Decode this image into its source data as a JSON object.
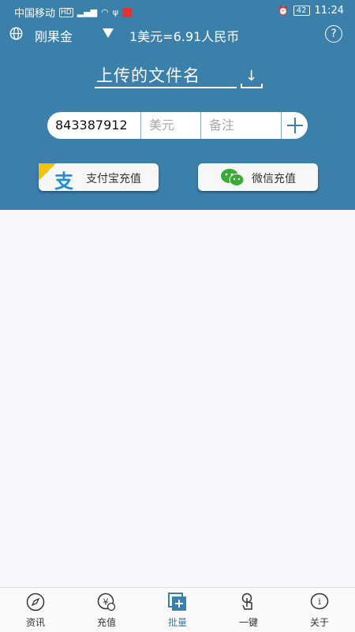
{
  "status_bar": {
    "carrier": "中国移动",
    "time": "11:24",
    "battery": "42"
  },
  "header": {
    "account_name": "刚果金",
    "exchange_rate": "1美元=6.91人民币",
    "help_label": "?"
  },
  "upload": {
    "filename_label": "上传的文件名"
  },
  "form": {
    "id_value": "843387912",
    "usd_placeholder": "美元",
    "note_placeholder": "备注"
  },
  "payment": {
    "alipay_label": "支付宝充值",
    "wechat_label": "微信充值",
    "alipay_logo_char": "支"
  },
  "tabs": [
    {
      "label": "资讯",
      "icon": "compass-icon"
    },
    {
      "label": "充值",
      "icon": "yen-coin-icon"
    },
    {
      "label": "批量",
      "icon": "batch-add-icon",
      "active": true
    },
    {
      "label": "一键",
      "icon": "one-touch-icon"
    },
    {
      "label": "关于",
      "icon": "info-icon"
    }
  ],
  "colors": {
    "primary": "#3b7fab",
    "alipay": "#1b8fd6",
    "wechat": "#3aa935"
  }
}
